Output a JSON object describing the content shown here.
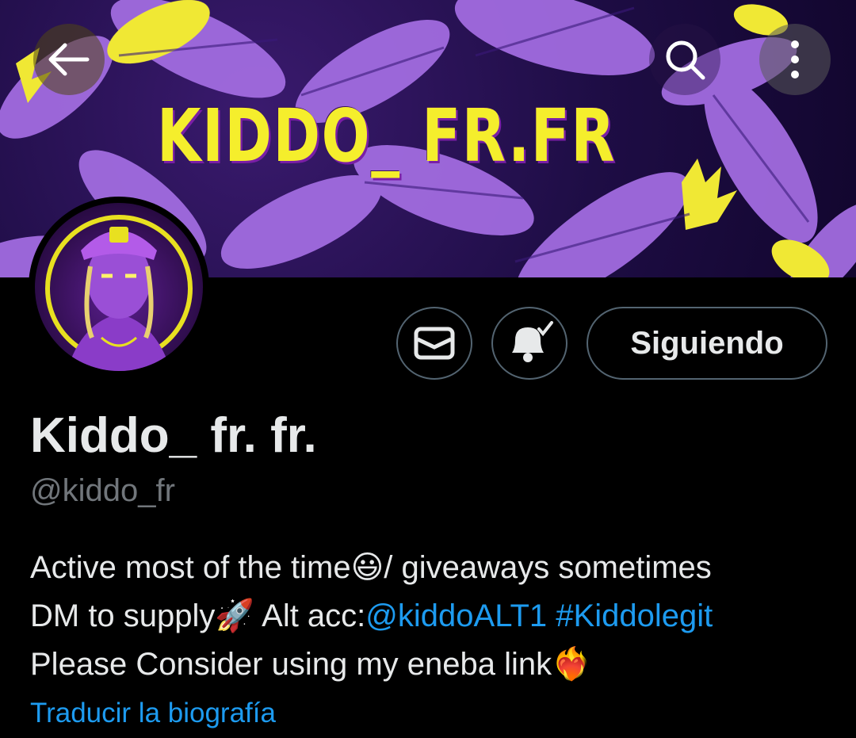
{
  "banner": {
    "title": "KIDDO_ FR.FR"
  },
  "nav": {
    "back_icon": "arrow-left-icon",
    "search_icon": "search-icon",
    "more_icon": "more-vertical-icon"
  },
  "profile": {
    "display_name": "Kiddo_ fr. fr.",
    "handle": "@kiddo_fr",
    "follow_label": "Siguiendo"
  },
  "bio": {
    "line1_text": "Active most of the time",
    "line1_emoji": "😃",
    "line1_rest": "/ giveaways sometimes",
    "line2_text": "DM to supply",
    "line2_emoji": "🚀",
    "line2_alt": " Alt acc:",
    "line2_mention": "@kiddoALT1",
    "line2_hashtag": "#Kiddolegit",
    "line3_text": "Please Consider using my eneba link",
    "line3_emoji": "❤️‍🔥"
  },
  "translate_label": "Traducir la biografía",
  "colors": {
    "accent": "#1d9bf0",
    "banner_yellow": "#f5ee2c",
    "banner_purple": "#a26ce0"
  }
}
